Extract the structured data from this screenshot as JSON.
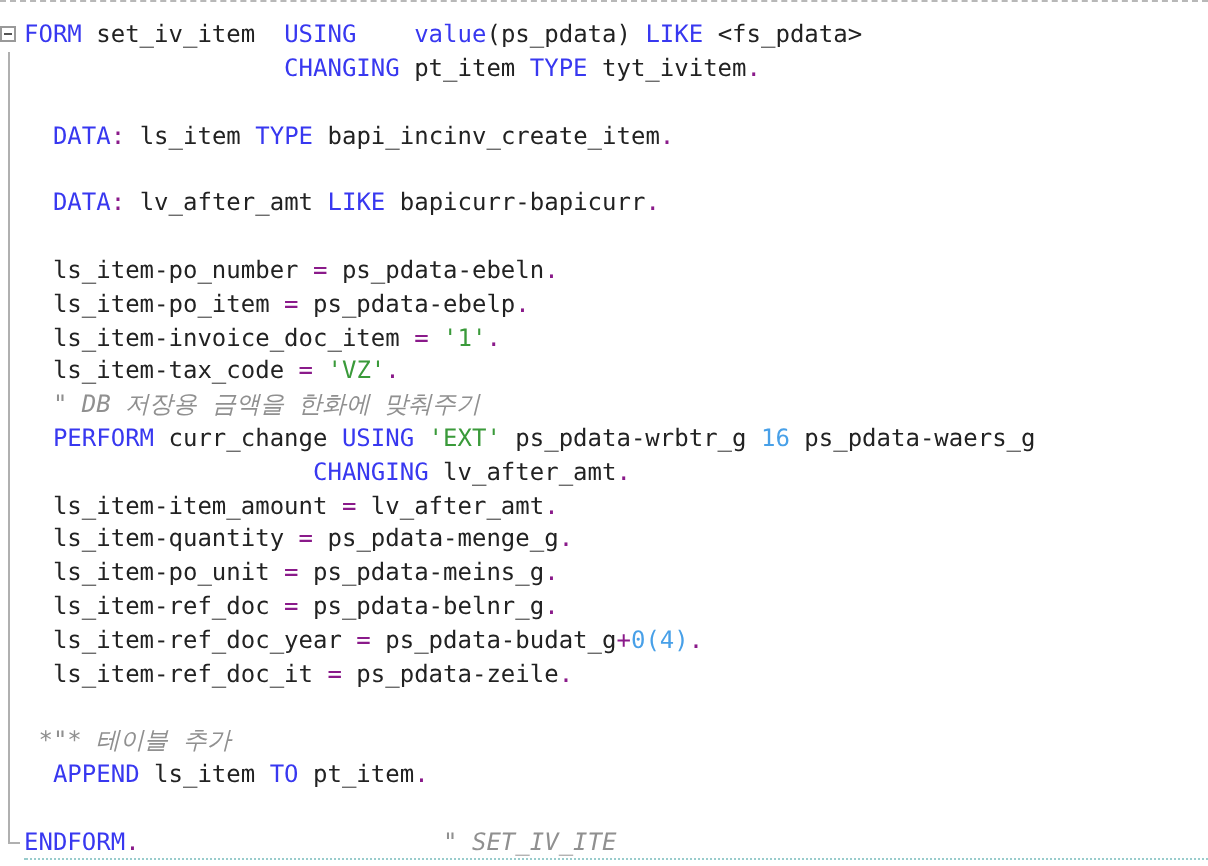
{
  "editor": {
    "lines": [
      {
        "expanded": true,
        "tokens": [
          {
            "kind": "kw",
            "text": "FORM"
          },
          {
            "kind": "id",
            "text": " set_iv_item  "
          },
          {
            "kind": "kw",
            "text": "USING    value"
          },
          {
            "kind": "id",
            "text": "(ps_pdata) "
          },
          {
            "kind": "kw",
            "text": "LIKE"
          },
          {
            "kind": "id",
            "text": " <fs_pdata>"
          }
        ]
      },
      {
        "tokens": [
          {
            "kind": "kw",
            "text": "                  CHANGING"
          },
          {
            "kind": "id",
            "text": " pt_item "
          },
          {
            "kind": "kw",
            "text": "TYPE"
          },
          {
            "kind": "id",
            "text": " tyt_ivitem"
          },
          {
            "kind": "op",
            "text": "."
          }
        ]
      },
      {
        "space_before": true,
        "tokens": [
          {
            "kind": "kw",
            "text": "  DATA"
          },
          {
            "kind": "op",
            "text": ":"
          },
          {
            "kind": "id",
            "text": " ls_item "
          },
          {
            "kind": "kw",
            "text": "TYPE"
          },
          {
            "kind": "id",
            "text": " bapi_incinv_create_item"
          },
          {
            "kind": "op",
            "text": "."
          }
        ]
      },
      {
        "space_before": true,
        "tokens": [
          {
            "kind": "kw",
            "text": "  DATA"
          },
          {
            "kind": "op",
            "text": ":"
          },
          {
            "kind": "id",
            "text": " lv_after_amt "
          },
          {
            "kind": "kw",
            "text": "LIKE"
          },
          {
            "kind": "id",
            "text": " bapicurr-bapicurr"
          },
          {
            "kind": "op",
            "text": "."
          }
        ]
      },
      {
        "space_before": true,
        "tokens": [
          {
            "kind": "id",
            "text": "  ls_item-po_number "
          },
          {
            "kind": "op",
            "text": "="
          },
          {
            "kind": "id",
            "text": " ps_pdata-ebeln"
          },
          {
            "kind": "op",
            "text": "."
          }
        ]
      },
      {
        "tokens": [
          {
            "kind": "id",
            "text": "  ls_item-po_item "
          },
          {
            "kind": "op",
            "text": "="
          },
          {
            "kind": "id",
            "text": " ps_pdata-ebelp"
          },
          {
            "kind": "op",
            "text": "."
          }
        ]
      },
      {
        "tokens": [
          {
            "kind": "id",
            "text": "  ls_item-invoice_doc_item "
          },
          {
            "kind": "op",
            "text": "="
          },
          {
            "kind": "str",
            "text": " '1'"
          },
          {
            "kind": "op",
            "text": "."
          }
        ]
      },
      {
        "tokens": [
          {
            "kind": "id",
            "text": "  ls_item-tax_code "
          },
          {
            "kind": "op",
            "text": "="
          },
          {
            "kind": "str",
            "text": " 'VZ'"
          },
          {
            "kind": "op",
            "text": "."
          }
        ]
      },
      {
        "tokens": [
          {
            "kind": "cmt",
            "text": "  \" DB 저장용 금액을 한화에 맞춰주기"
          }
        ]
      },
      {
        "tokens": [
          {
            "kind": "kw",
            "text": "  PERFORM"
          },
          {
            "kind": "id",
            "text": " curr_change "
          },
          {
            "kind": "kw",
            "text": "USING"
          },
          {
            "kind": "str",
            "text": " 'EXT'"
          },
          {
            "kind": "id",
            "text": " ps_pdata-wrbtr_g "
          },
          {
            "kind": "num",
            "text": "16"
          },
          {
            "kind": "id",
            "text": " ps_pdata-waers_g"
          }
        ]
      },
      {
        "tokens": [
          {
            "kind": "kw",
            "text": "                    CHANGING"
          },
          {
            "kind": "id",
            "text": " lv_after_amt"
          },
          {
            "kind": "op",
            "text": "."
          }
        ]
      },
      {
        "tokens": [
          {
            "kind": "id",
            "text": "  ls_item-item_amount "
          },
          {
            "kind": "op",
            "text": "="
          },
          {
            "kind": "id",
            "text": " lv_after_amt"
          },
          {
            "kind": "op",
            "text": "."
          }
        ]
      },
      {
        "tokens": [
          {
            "kind": "id",
            "text": "  ls_item-quantity "
          },
          {
            "kind": "op",
            "text": "="
          },
          {
            "kind": "id",
            "text": " ps_pdata-menge_g"
          },
          {
            "kind": "op",
            "text": "."
          }
        ]
      },
      {
        "tokens": [
          {
            "kind": "id",
            "text": "  ls_item-po_unit "
          },
          {
            "kind": "op",
            "text": "="
          },
          {
            "kind": "id",
            "text": " ps_pdata-meins_g"
          },
          {
            "kind": "op",
            "text": "."
          }
        ]
      },
      {
        "tokens": [
          {
            "kind": "id",
            "text": "  ls_item-ref_doc "
          },
          {
            "kind": "op",
            "text": "="
          },
          {
            "kind": "id",
            "text": " ps_pdata-belnr_g"
          },
          {
            "kind": "op",
            "text": "."
          }
        ]
      },
      {
        "tokens": [
          {
            "kind": "id",
            "text": "  ls_item-ref_doc_year "
          },
          {
            "kind": "op",
            "text": "="
          },
          {
            "kind": "id",
            "text": " ps_pdata-budat_g"
          },
          {
            "kind": "op",
            "text": "+"
          },
          {
            "kind": "num",
            "text": "0(4)"
          },
          {
            "kind": "op",
            "text": "."
          }
        ]
      },
      {
        "tokens": [
          {
            "kind": "id",
            "text": "  ls_item-ref_doc_it "
          },
          {
            "kind": "op",
            "text": "="
          },
          {
            "kind": "id",
            "text": " ps_pdata-zeile"
          },
          {
            "kind": "op",
            "text": "."
          }
        ]
      },
      {
        "space_before": true,
        "tokens": [
          {
            "kind": "cmt",
            "text": " *\"* 테이블 추가"
          }
        ]
      },
      {
        "tokens": [
          {
            "kind": "kw",
            "text": "  APPEND"
          },
          {
            "kind": "id",
            "text": " ls_item "
          },
          {
            "kind": "kw",
            "text": "TO"
          },
          {
            "kind": "id",
            "text": " pt_item"
          },
          {
            "kind": "op",
            "text": "."
          }
        ]
      },
      {
        "space_before": true,
        "tokens": [
          {
            "kind": "kw",
            "text": "ENDFORM"
          },
          {
            "kind": "op",
            "text": "."
          },
          {
            "kind": "cmt",
            "text": "                     \" SET_IV_ITE"
          }
        ]
      }
    ]
  }
}
